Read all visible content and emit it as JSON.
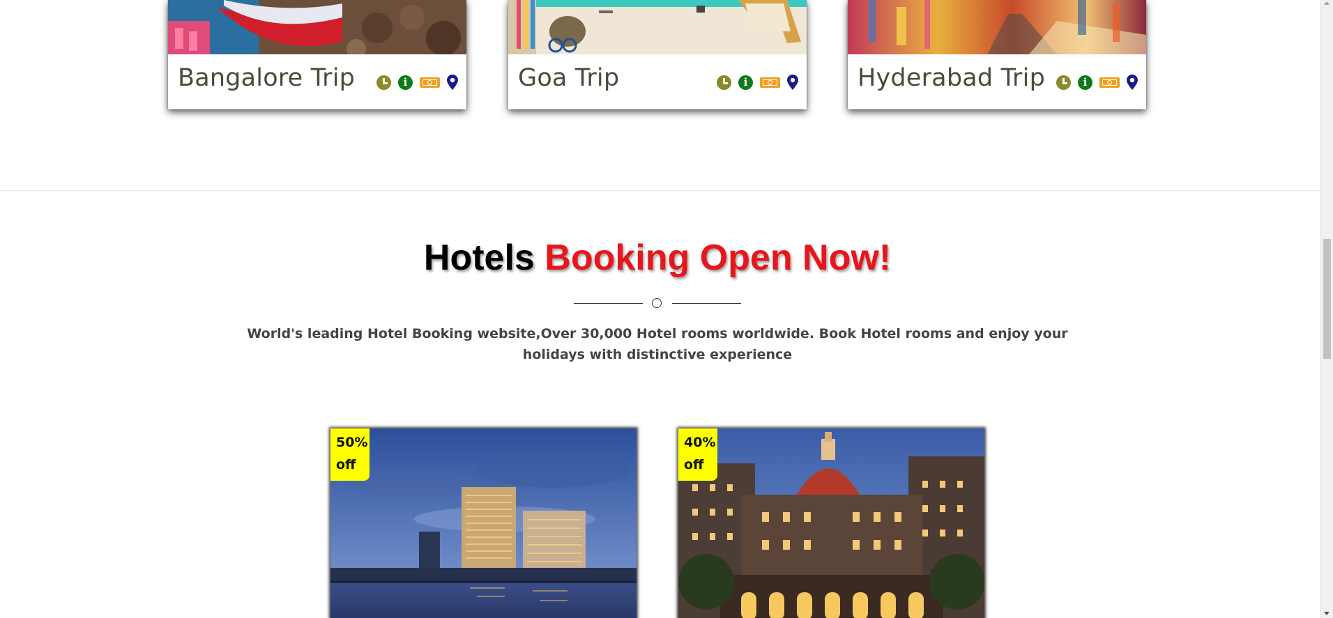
{
  "trips": [
    {
      "title": "Bangalore Trip",
      "icons": [
        "clock-icon",
        "info-icon",
        "ticket-icon",
        "map-pin-icon"
      ]
    },
    {
      "title": "Goa Trip",
      "icons": [
        "clock-icon",
        "info-icon",
        "ticket-icon",
        "map-pin-icon"
      ]
    },
    {
      "title": "Hyderabad Trip",
      "icons": [
        "clock-icon",
        "info-icon",
        "ticket-icon",
        "map-pin-icon"
      ]
    }
  ],
  "hotels_section": {
    "heading_black": "Hotels",
    "heading_red": "Booking Open Now!",
    "intro": "World's leading Hotel Booking website,Over 30,000 Hotel rooms worldwide. Book Hotel rooms and enjoy your holidays with distinctive experience"
  },
  "hotels": [
    {
      "discount_value": "50%",
      "discount_unit": "off"
    },
    {
      "discount_value": "40%",
      "discount_unit": "off"
    }
  ],
  "colors": {
    "heading_red": "#e8161c",
    "badge_yellow": "#ffff00",
    "clock_olive": "#8a8a2a",
    "info_green": "#0f7a1a",
    "ticket_orange": "#f0a020",
    "pin_navy": "#1a1a8c"
  }
}
